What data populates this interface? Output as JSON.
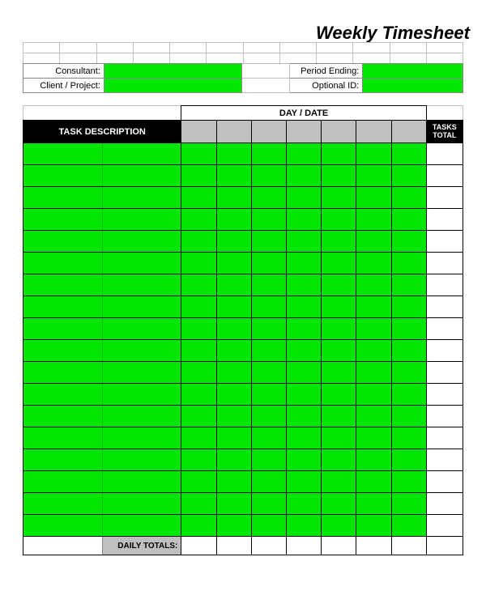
{
  "title": "Weekly Timesheet",
  "meta": {
    "consultant_label": "Consultant:",
    "consultant_value": "",
    "period_ending_label": "Period Ending:",
    "period_ending_value": "",
    "client_project_label": "Client / Project:",
    "client_project_value": "",
    "optional_id_label": "Optional ID:",
    "optional_id_value": ""
  },
  "grid": {
    "day_date_label": "DAY / DATE",
    "task_description_label": "TASK DESCRIPTION",
    "tasks_total_label": "TASKS TOTAL",
    "daily_totals_label": "DAILY TOTALS:",
    "day_columns": [
      "",
      "",
      "",
      "",
      "",
      "",
      ""
    ],
    "rows": [
      {
        "description": "",
        "days": [
          "",
          "",
          "",
          "",
          "",
          "",
          ""
        ],
        "total": ""
      },
      {
        "description": "",
        "days": [
          "",
          "",
          "",
          "",
          "",
          "",
          ""
        ],
        "total": ""
      },
      {
        "description": "",
        "days": [
          "",
          "",
          "",
          "",
          "",
          "",
          ""
        ],
        "total": ""
      },
      {
        "description": "",
        "days": [
          "",
          "",
          "",
          "",
          "",
          "",
          ""
        ],
        "total": ""
      },
      {
        "description": "",
        "days": [
          "",
          "",
          "",
          "",
          "",
          "",
          ""
        ],
        "total": ""
      },
      {
        "description": "",
        "days": [
          "",
          "",
          "",
          "",
          "",
          "",
          ""
        ],
        "total": ""
      },
      {
        "description": "",
        "days": [
          "",
          "",
          "",
          "",
          "",
          "",
          ""
        ],
        "total": ""
      },
      {
        "description": "",
        "days": [
          "",
          "",
          "",
          "",
          "",
          "",
          ""
        ],
        "total": ""
      },
      {
        "description": "",
        "days": [
          "",
          "",
          "",
          "",
          "",
          "",
          ""
        ],
        "total": ""
      },
      {
        "description": "",
        "days": [
          "",
          "",
          "",
          "",
          "",
          "",
          ""
        ],
        "total": ""
      },
      {
        "description": "",
        "days": [
          "",
          "",
          "",
          "",
          "",
          "",
          ""
        ],
        "total": ""
      },
      {
        "description": "",
        "days": [
          "",
          "",
          "",
          "",
          "",
          "",
          ""
        ],
        "total": ""
      },
      {
        "description": "",
        "days": [
          "",
          "",
          "",
          "",
          "",
          "",
          ""
        ],
        "total": ""
      },
      {
        "description": "",
        "days": [
          "",
          "",
          "",
          "",
          "",
          "",
          ""
        ],
        "total": ""
      },
      {
        "description": "",
        "days": [
          "",
          "",
          "",
          "",
          "",
          "",
          ""
        ],
        "total": ""
      },
      {
        "description": "",
        "days": [
          "",
          "",
          "",
          "",
          "",
          "",
          ""
        ],
        "total": ""
      },
      {
        "description": "",
        "days": [
          "",
          "",
          "",
          "",
          "",
          "",
          ""
        ],
        "total": ""
      },
      {
        "description": "",
        "days": [
          "",
          "",
          "",
          "",
          "",
          "",
          ""
        ],
        "total": ""
      }
    ],
    "daily_totals": [
      "",
      "",
      "",
      "",
      "",
      "",
      ""
    ],
    "grand_total": ""
  },
  "colors": {
    "highlight_green": "#00e600",
    "header_black": "#000000",
    "header_grey": "#bfbfbf"
  }
}
